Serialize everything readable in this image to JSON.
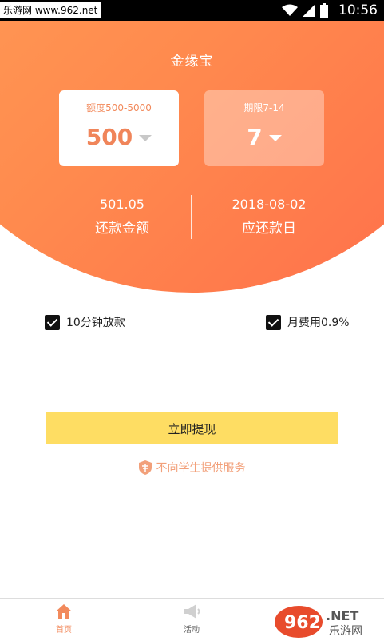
{
  "status_bar": {
    "watermark": "乐游网 www.962.net",
    "time": "10:56"
  },
  "app": {
    "title": "金缘宝"
  },
  "amount_card": {
    "caption": "额度500-5000",
    "value": "500"
  },
  "period_card": {
    "caption": "期限7-14",
    "value": "7"
  },
  "repayment": {
    "amount_value": "501.05",
    "amount_label": "还款金额",
    "date_value": "2018-08-02",
    "date_label": "应还款日"
  },
  "options": {
    "fast_loan": "10分钟放款",
    "monthly_fee": "月费用0.9%"
  },
  "withdraw_button": "立即提现",
  "notice": "不向学生提供服务",
  "bottom_nav": {
    "home": "首页",
    "activity": "活动"
  },
  "watermark_logo": {
    "brand": "962",
    ".net": ".NET",
    "cn": "乐游网"
  },
  "colors": {
    "accent": "#ff8a4e",
    "button": "#fedd63"
  }
}
